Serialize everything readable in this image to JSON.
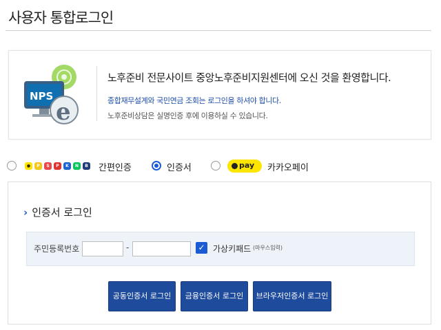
{
  "page": {
    "title": "사용자 통합로그인"
  },
  "welcome": {
    "logo_text": "NPS",
    "headline": "노후준비 전문사이트 중앙노후준비지원센터에 오신 것을 환영합니다.",
    "notice_blue": "종합재무설계와 국민연금 조회는 로그인을 하셔야 합니다.",
    "notice_gray": "노후준비상담은 실명인증 후에 이용하실 수 있습니다."
  },
  "login_options": {
    "selected": "인증서",
    "simple_auth_label": "간편인증",
    "certificate_label": "인증서",
    "kakao_pay_text": "pay",
    "kakao_pay_label": "카카오페이",
    "provider_icons": [
      {
        "name": "kakao-icon",
        "color": "#fee500",
        "glyph": "●"
      },
      {
        "name": "payco-icon",
        "color": "#f2c81b",
        "glyph": "P"
      },
      {
        "name": "samsung-pass-icon",
        "color": "#e84a4a",
        "glyph": "S"
      },
      {
        "name": "pass-icon",
        "color": "#e0322f",
        "glyph": "P"
      },
      {
        "name": "kb-icon",
        "color": "#1b63d0",
        "glyph": "K"
      },
      {
        "name": "naver-icon",
        "color": "#03c75a",
        "glyph": "N"
      },
      {
        "name": "bank-icon",
        "color": "#1f3d7a",
        "glyph": "B"
      }
    ]
  },
  "cert_login": {
    "section_title": "인증서 로그인",
    "ssn_label": "주민등록번호",
    "ssn_front_value": "",
    "ssn_back_value": "",
    "virtual_keypad_label": "가상키패드",
    "virtual_keypad_hint": "(마우스입력)",
    "virtual_keypad_checked": true,
    "buttons": {
      "joint_cert": "공동인증서 로그인",
      "finance_cert": "금융인증서 로그인",
      "browser_cert": "브라우저인증서 로그인"
    }
  }
}
